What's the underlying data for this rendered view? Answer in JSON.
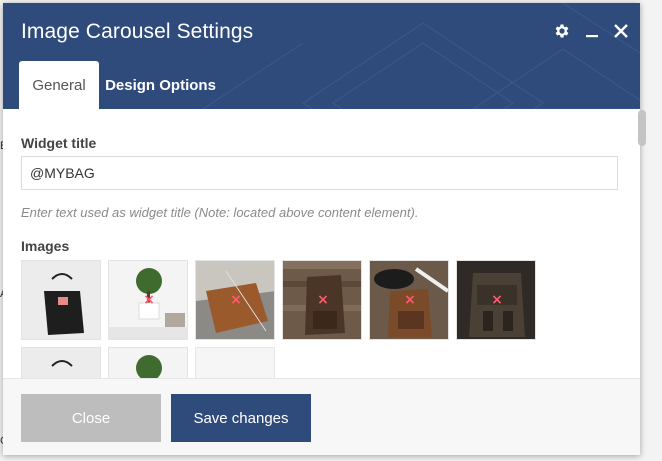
{
  "modal": {
    "title": "Image Carousel Settings",
    "tabs": [
      {
        "label": "General",
        "active": true
      },
      {
        "label": "Design Options",
        "active": false
      }
    ],
    "header_icons": [
      "gear-icon",
      "minimize-icon",
      "close-icon"
    ]
  },
  "widget_title": {
    "label": "Widget title",
    "value": "@MYBAG",
    "help": "Enter text used as widget title (Note: located above content element)."
  },
  "images": {
    "label": "Images",
    "items": [
      {
        "name": "black-leather-tote-bag"
      },
      {
        "name": "bonsai-plant-desk"
      },
      {
        "name": "brown-clutch-pattern"
      },
      {
        "name": "leather-backpack-wood"
      },
      {
        "name": "backpack-hat-lifestyle"
      },
      {
        "name": "dark-leather-backpack"
      },
      {
        "name": "black-leather-tote-bag-2"
      },
      {
        "name": "bonsai-plant-desk-2"
      }
    ],
    "remove_symbol": "×"
  },
  "footer": {
    "close_label": "Close",
    "save_label": "Save changes"
  },
  "colors": {
    "header": "#2f4b7c",
    "primary_button": "#2f4b7c",
    "close_button": "#bdbdbd",
    "remove_icon": "#ff5a6e"
  }
}
